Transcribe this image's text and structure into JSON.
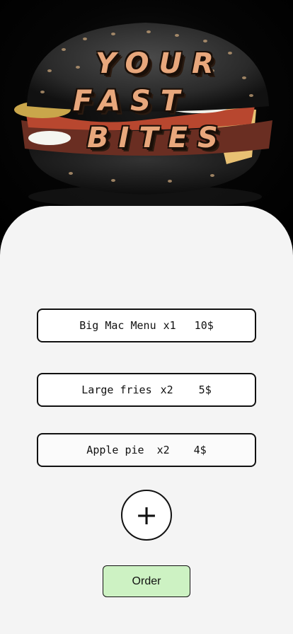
{
  "hero": {
    "title_line1": "YOUR",
    "title_line2": "FAST",
    "title_line3": "BITES",
    "image_icon": "burger-image"
  },
  "order_items": [
    {
      "name": "Big Mac Menu",
      "qty": "x1",
      "price": "10$"
    },
    {
      "name": "Large fries",
      "qty": "x2",
      "price": "5$"
    },
    {
      "name": "Apple pie",
      "qty": "x2",
      "price": "4$"
    }
  ],
  "add_button": {
    "label": "+",
    "icon": "plus-icon"
  },
  "order_button": {
    "label": "Order"
  },
  "colors": {
    "title_fill": "#e8a77c",
    "panel_bg": "#f4f4f4",
    "order_button_bg": "#cdf2c3"
  }
}
